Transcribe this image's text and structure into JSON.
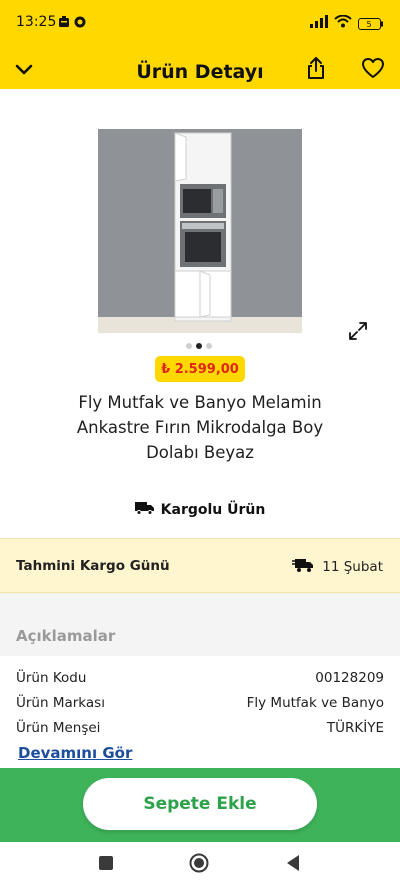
{
  "status": {
    "time": "13:25",
    "battery": "5"
  },
  "header": {
    "title": "Ürün Detayı"
  },
  "product": {
    "price": "₺ 2.599,00",
    "title": "Fly Mutfak ve Banyo Melamin Ankastre Fırın Mikrodalga Boy Dolabı Beyaz",
    "cargo_label": "Kargolu Ürün",
    "image_count": 3,
    "active_image": 1
  },
  "shipping": {
    "label": "Tahmini Kargo Günü",
    "date": "11 Şubat"
  },
  "description": {
    "title": "Açıklamalar",
    "rows": [
      {
        "label": "Ürün Kodu",
        "value": "00128209"
      },
      {
        "label": "Ürün Markası",
        "value": "Fly Mutfak ve Banyo"
      },
      {
        "label": "Ürün Menşei",
        "value": "TÜRKİYE"
      }
    ],
    "more_link": "Devamını Gör"
  },
  "cta": {
    "add_to_cart": "Sepete Ekle"
  },
  "colors": {
    "brand_yellow": "#ffd800",
    "price_red": "#e1251b",
    "cta_green": "#3fb359",
    "link_blue": "#1d4e9e"
  },
  "icons": {
    "back": "chevron-down-icon",
    "share": "share-icon",
    "favorite": "heart-icon",
    "expand": "expand-icon",
    "truck": "truck-icon",
    "shipping": "fast-truck-icon"
  }
}
